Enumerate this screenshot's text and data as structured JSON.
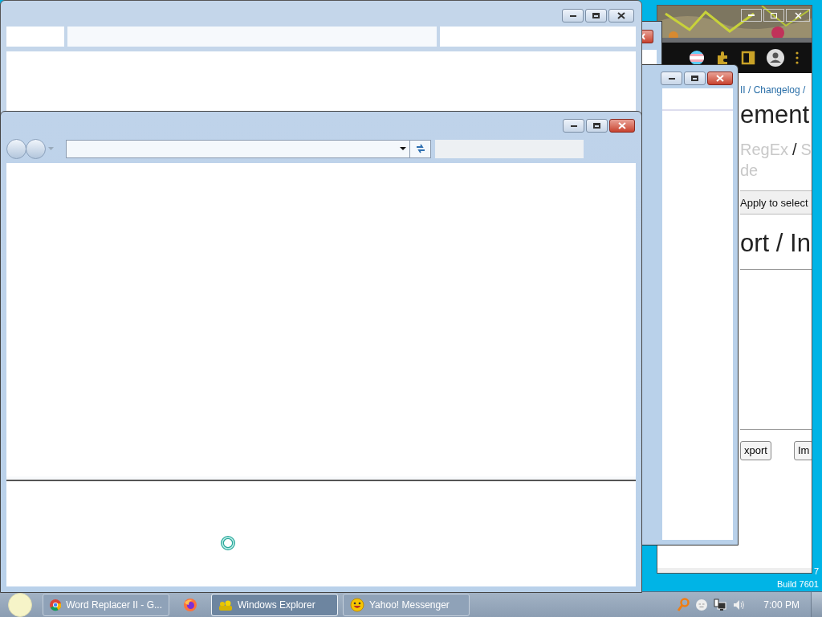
{
  "browser": {
    "breadcrumb": "II / Changelog /",
    "heading": "ement",
    "links": [
      {
        "text": "RegEx",
        "kind": "link"
      },
      {
        "text": "/",
        "kind": "separator"
      },
      {
        "text": "S",
        "kind": "link"
      }
    ],
    "link_continuation": "de",
    "apply_button": "Apply to select",
    "section_heading": "ort / In",
    "buttons": [
      "xport",
      "Im"
    ]
  },
  "desktop": {
    "version": "7",
    "build": "Build 7601"
  },
  "taskbar": {
    "items": [
      {
        "kind": "chrome",
        "label": "Word Replacer II - G...",
        "selected": false
      },
      {
        "kind": "firefox",
        "selected": false
      },
      {
        "kind": "explorer",
        "label": "Windows Explorer",
        "selected": true
      },
      {
        "kind": "messenger",
        "label": "Yahoo! Messenger",
        "selected": false
      }
    ],
    "clock": "7:00 PM"
  }
}
